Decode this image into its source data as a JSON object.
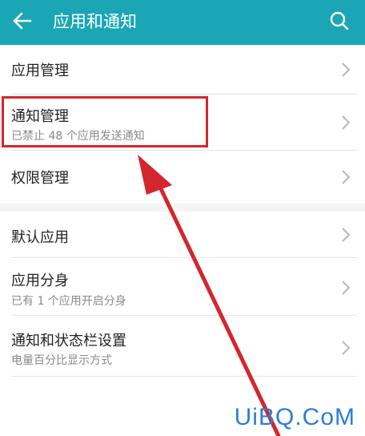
{
  "header": {
    "title": "应用和通知",
    "back_icon": "arrow-left-icon",
    "search_icon": "search-icon",
    "color": "#1aa6b5"
  },
  "groups": [
    {
      "items": [
        {
          "label": "应用管理"
        },
        {
          "label": "通知管理",
          "subtitle": "已禁止 48 个应用发送通知",
          "highlighted": true
        },
        {
          "label": "权限管理"
        }
      ]
    },
    {
      "items": [
        {
          "label": "默认应用"
        },
        {
          "label": "应用分身",
          "subtitle": "已有 1 个应用开启分身"
        },
        {
          "label": "通知和状态栏设置",
          "subtitle": "电量百分比显示方式"
        }
      ]
    }
  ],
  "annotation": {
    "highlight_color": "#d4262e",
    "arrow_color": "#d4262e"
  },
  "watermark": "UiBQ.CoM"
}
